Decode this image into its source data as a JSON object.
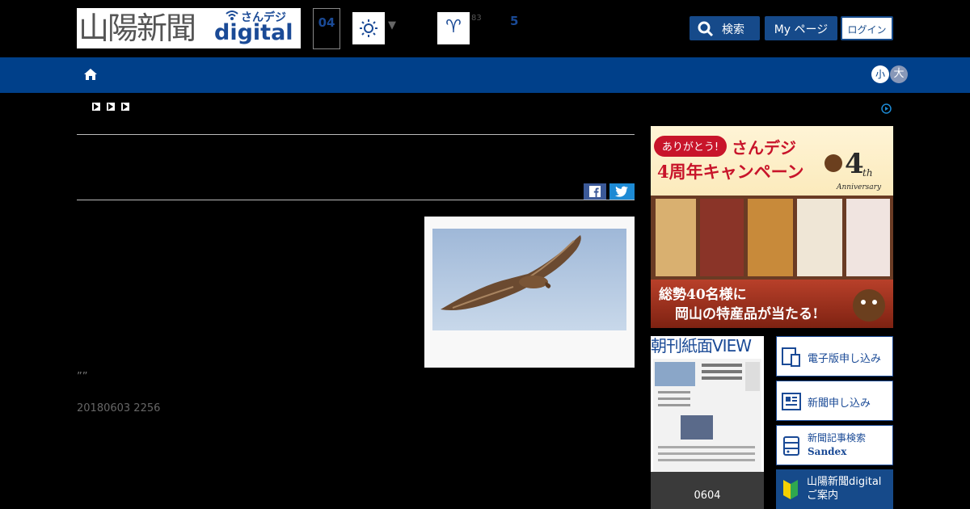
{
  "header": {
    "logo_kanji": "山陽新聞",
    "logo_sandeji": "さんデジ",
    "logo_digital": "digital",
    "date_day": "04",
    "weather_icon": "sun-icon",
    "weather_dropdown": "▼",
    "zodiac_symbol": "♈",
    "zodiac_small": "83",
    "zodiac_rank": "5",
    "search_label": "検索",
    "mypage_label": "My ページ",
    "login_label": "ログイン"
  },
  "nav": {
    "home_icon": "home-icon",
    "font_small": "小",
    "font_large": "大"
  },
  "article": {
    "quote": "””",
    "timestamp": "20180603 2256"
  },
  "ad": {
    "thanks": "ありがとう!",
    "campaign_line1": "さんデジ",
    "campaign_line2": "4周年キャンペーン",
    "badge": "4th",
    "badge_sub": "Anniversary",
    "prize_line1": "総勢40名様に",
    "prize_line2": "岡山の特産品が当たる!"
  },
  "sidebar": {
    "viewer_title": "朝刊紙面VIEW",
    "viewer_date": "0604",
    "buttons": [
      {
        "label": "電子版申し込み"
      },
      {
        "label": "新聞申し込み"
      },
      {
        "label_line1": "新聞記事検索",
        "label_line2": "Sandex"
      },
      {
        "label_line1": "山陽新聞digital",
        "label_line2": "ご案内"
      }
    ]
  },
  "colors": {
    "brand_blue": "#00408a",
    "button_blue": "#164a8a",
    "facebook": "#3b5998",
    "twitter": "#1d8ad4"
  }
}
